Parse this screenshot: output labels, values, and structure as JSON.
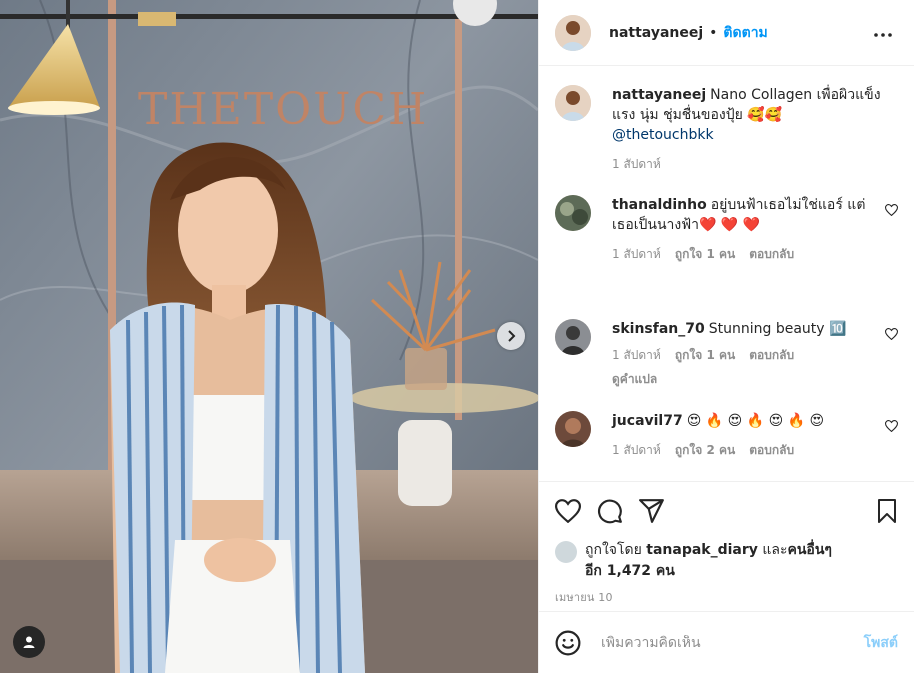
{
  "post": {
    "author": "nattayaneej",
    "follow_label": "ติดตาม",
    "dot": "•",
    "more_icon": "more-horizontal-icon",
    "caption_text": "Nano Collagen เพื่อผิวแข็งแรง นุ่ม ชุ่มชื่นของปุ้ย 🥰🥰",
    "caption_mention": "@thetouchbkk",
    "caption_time": "1 สัปดาห์",
    "photo_sign": "THETOUCH"
  },
  "comments": [
    {
      "user": "thanaldinho",
      "text": "อยู่บนฟ้าเธอไม่ใช่แอร์ แต่เธอเป็นนางฟ้า❤️ ❤️ ❤️",
      "time": "1 สัปดาห์",
      "likes": "ถูกใจ 1 คน",
      "reply": "ตอบกลับ"
    },
    {
      "user": "skinsfan_70",
      "text": "Stunning beauty 🔟",
      "time": "1 สัปดาห์",
      "likes": "ถูกใจ 1 คน",
      "reply": "ตอบกลับ",
      "translate": "ดูคำแปล"
    },
    {
      "user": "jucavil77",
      "text": "😍 🔥 😍 🔥 😍 🔥 😍",
      "time": "1 สัปดาห์",
      "likes": "ถูกใจ 2 คน",
      "reply": "ตอบกลับ"
    }
  ],
  "actions": {
    "liked_by_prefix": "ถูกใจโดย",
    "liked_by_user": "tanapak_diary",
    "liked_by_and": "และ",
    "liked_by_others": "คนอื่นๆ",
    "liked_by_count": "อีก 1,472 คน",
    "date": "เมษายน 10"
  },
  "add_comment": {
    "placeholder": "เพิ่มความคิดเห็น",
    "post_label": "โพสต์"
  },
  "colors": {
    "accent": "#0095f6",
    "mention": "#00376b",
    "muted": "#8e8e8e",
    "heart": "#ed4956"
  }
}
